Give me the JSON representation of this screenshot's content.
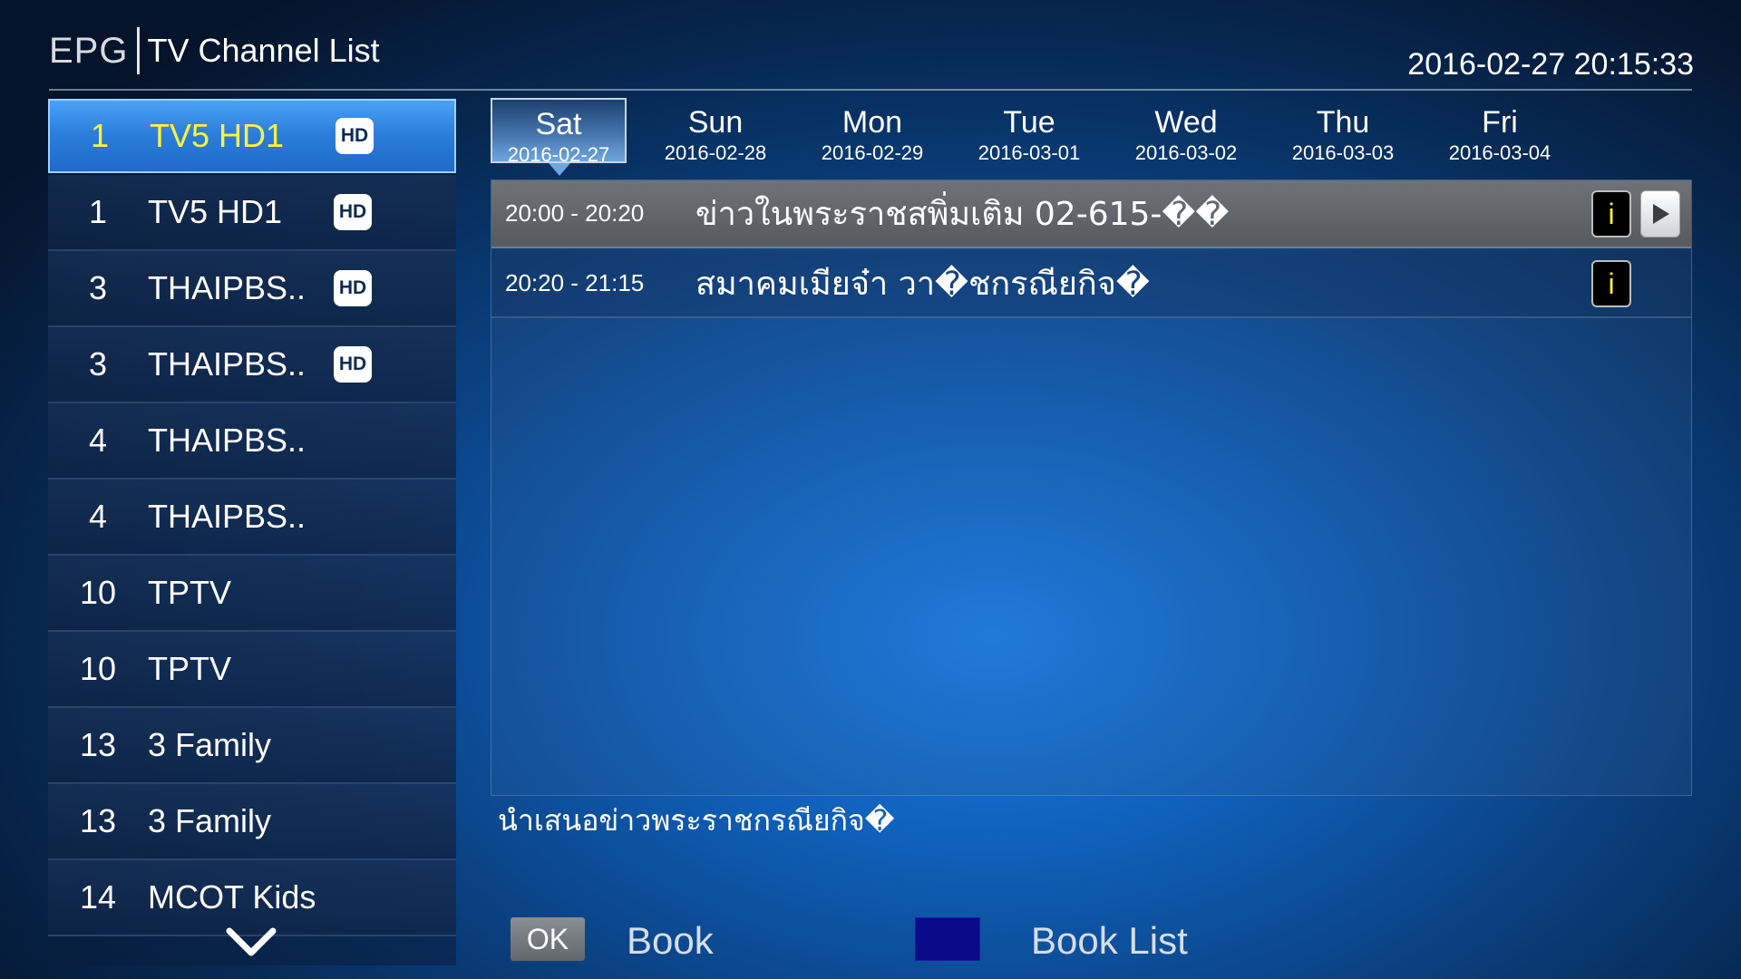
{
  "header": {
    "epg_label": "EPG",
    "title": "TV Channel List",
    "datetime": "2016-02-27 20:15:33"
  },
  "channels": [
    {
      "number": "1",
      "name": "TV5 HD1",
      "hd": true,
      "selected": true
    },
    {
      "number": "1",
      "name": "TV5 HD1",
      "hd": true,
      "selected": false
    },
    {
      "number": "3",
      "name": "THAIPBS..",
      "hd": true,
      "selected": false
    },
    {
      "number": "3",
      "name": "THAIPBS..",
      "hd": true,
      "selected": false
    },
    {
      "number": "4",
      "name": "THAIPBS..",
      "hd": false,
      "selected": false
    },
    {
      "number": "4",
      "name": "THAIPBS..",
      "hd": false,
      "selected": false
    },
    {
      "number": "10",
      "name": "TPTV",
      "hd": false,
      "selected": false
    },
    {
      "number": "10",
      "name": "TPTV",
      "hd": false,
      "selected": false
    },
    {
      "number": "13",
      "name": "3 Family",
      "hd": false,
      "selected": false
    },
    {
      "number": "13",
      "name": "3 Family",
      "hd": false,
      "selected": false
    },
    {
      "number": "14",
      "name": "MCOT Kids",
      "hd": false,
      "selected": false
    }
  ],
  "hd_badge_label": "HD",
  "dates": [
    {
      "day": "Sat",
      "date": "2016-02-27",
      "active": true
    },
    {
      "day": "Sun",
      "date": "2016-02-28",
      "active": false
    },
    {
      "day": "Mon",
      "date": "2016-02-29",
      "active": false
    },
    {
      "day": "Tue",
      "date": "2016-03-01",
      "active": false
    },
    {
      "day": "Wed",
      "date": "2016-03-02",
      "active": false
    },
    {
      "day": "Thu",
      "date": "2016-03-03",
      "active": false
    },
    {
      "day": "Fri",
      "date": "2016-03-04",
      "active": false
    }
  ],
  "programs": [
    {
      "time": "20:00 - 20:20",
      "title": "ข่าวในพระราชสพิ่มเติม 02-615-��",
      "selected": true,
      "has_play": true
    },
    {
      "time": "20:20 - 21:15",
      "title": "สมาคมเมียจ๋า วา�ชกรณียกิจ�",
      "selected": false,
      "has_play": false
    }
  ],
  "info_icon_label": "i",
  "description": "นำเสนอข่าวพระราชกรณียกิจ�",
  "footer": {
    "ok_key": "OK",
    "book_label": "Book",
    "booklist_label": "Book List",
    "blue_key_color": "#0a0a8a"
  },
  "colors": {
    "selected_text": "#fff23a",
    "accent_blue": "#2c7fdc"
  }
}
